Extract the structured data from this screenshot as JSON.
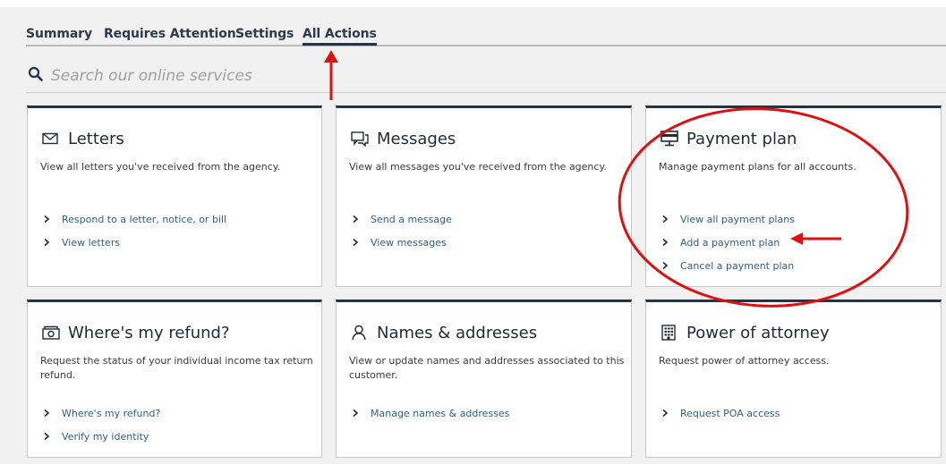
{
  "tabs": [
    {
      "label": "Summary",
      "active": false
    },
    {
      "label": "Requires Attention",
      "active": false
    },
    {
      "label": "Settings",
      "active": false
    },
    {
      "label": "All Actions",
      "active": true
    }
  ],
  "search": {
    "placeholder": "Search our online services",
    "icon": "search-icon"
  },
  "cards": [
    {
      "title": "Letters",
      "icon": "envelope-icon",
      "description": "View all letters you've received from the agency.",
      "links": [
        "Respond to a letter, notice, or bill",
        "View letters"
      ]
    },
    {
      "title": "Messages",
      "icon": "message-icon",
      "description": "View all messages you've received from the agency.",
      "links": [
        "Send a message",
        "View messages"
      ]
    },
    {
      "title": "Payment plan",
      "icon": "payment-plan-icon",
      "description": "Manage payment plans for all accounts.",
      "links": [
        "View all payment plans",
        "Add a payment plan",
        "Cancel a payment plan"
      ]
    },
    {
      "title": "Where's my refund?",
      "icon": "refund-icon",
      "description": "Request the status of your individual income tax return refund.",
      "links": [
        "Where's my refund?",
        "Verify my identity"
      ]
    },
    {
      "title": "Names & addresses",
      "icon": "person-icon",
      "description": "View or update names and addresses associated to this customer.",
      "links": [
        "Manage names & addresses"
      ]
    },
    {
      "title": "Power of attorney",
      "icon": "building-icon",
      "description": "Request power of attorney access.",
      "links": [
        "Request POA access"
      ]
    }
  ],
  "colors": {
    "tab_accent": "#243447",
    "link": "#2f5f8a",
    "annotation": "#e01010"
  }
}
